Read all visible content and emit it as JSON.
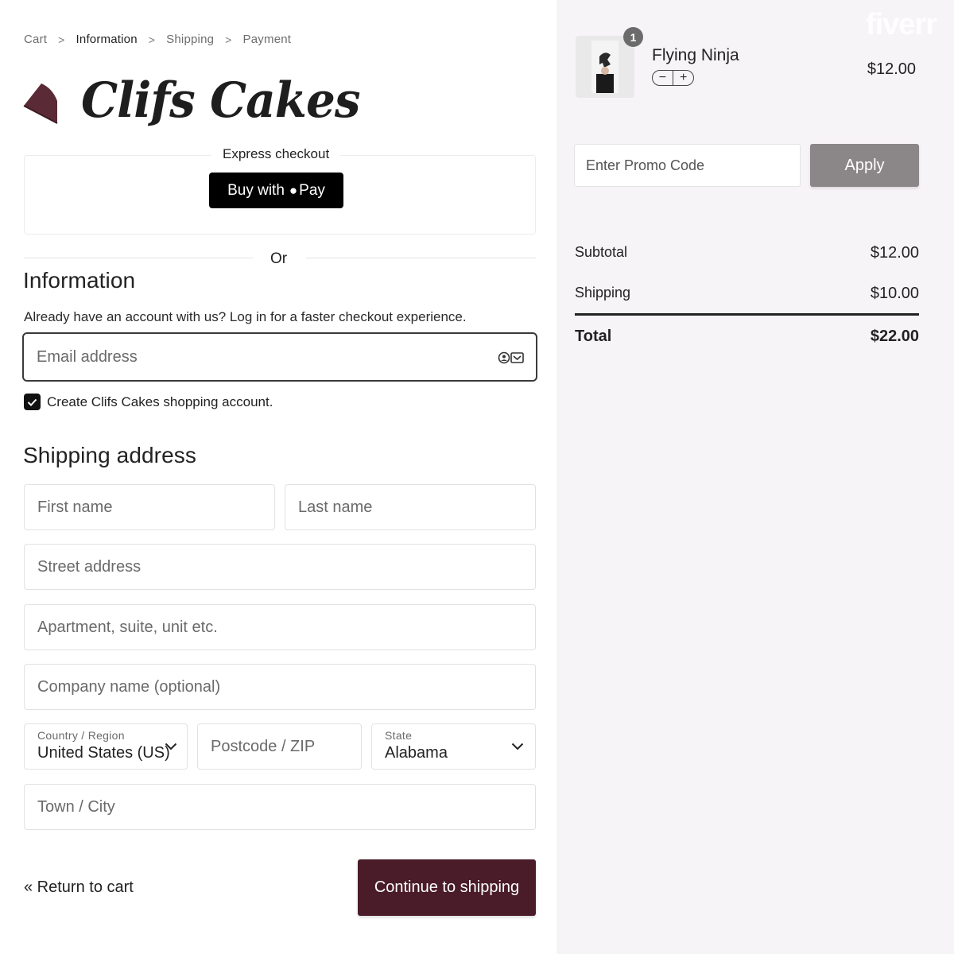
{
  "breadcrumb": {
    "items": [
      {
        "label": "Cart",
        "active": false
      },
      {
        "label": "Information",
        "active": true
      },
      {
        "label": "Shipping",
        "active": false
      },
      {
        "label": "Payment",
        "active": false
      }
    ],
    "separator": ">"
  },
  "brand": {
    "name": "Clifs Cakes",
    "color": "#5a2a36"
  },
  "express": {
    "label": "Express checkout",
    "apple_pay_prefix": "Buy with",
    "apple_pay_suffix": "Pay",
    "or_text": "Or"
  },
  "information": {
    "heading": "Information",
    "login_hint": "Already have an account with us? Log in for a faster checkout experience.",
    "email_placeholder": "Email address",
    "create_account_label": "Create Clifs Cakes shopping account.",
    "create_account_checked": true
  },
  "shipping": {
    "heading": "Shipping address",
    "first_name_placeholder": "First name",
    "last_name_placeholder": "Last name",
    "street_placeholder": "Street address",
    "apartment_placeholder": "Apartment, suite, unit etc.",
    "company_placeholder": "Company name (optional)",
    "country_label": "Country / Region",
    "country_value": "United States (US)",
    "postcode_placeholder": "Postcode / ZIP",
    "state_label": "State",
    "state_value": "Alabama",
    "town_placeholder": "Town / City"
  },
  "actions": {
    "return_label": "« Return to cart",
    "continue_label": "Continue to shipping",
    "continue_color": "#4a1c2a"
  },
  "order": {
    "item": {
      "name": "Flying Ninja",
      "price": "$12.00",
      "quantity": "1",
      "minus": "−",
      "plus": "+"
    },
    "promo_placeholder": "Enter Promo Code",
    "apply_label": "Apply",
    "subtotal_label": "Subtotal",
    "subtotal_value": "$12.00",
    "shipping_label": "Shipping",
    "shipping_value": "$10.00",
    "total_label": "Total",
    "total_value": "$22.00"
  },
  "watermark": "fiverr"
}
